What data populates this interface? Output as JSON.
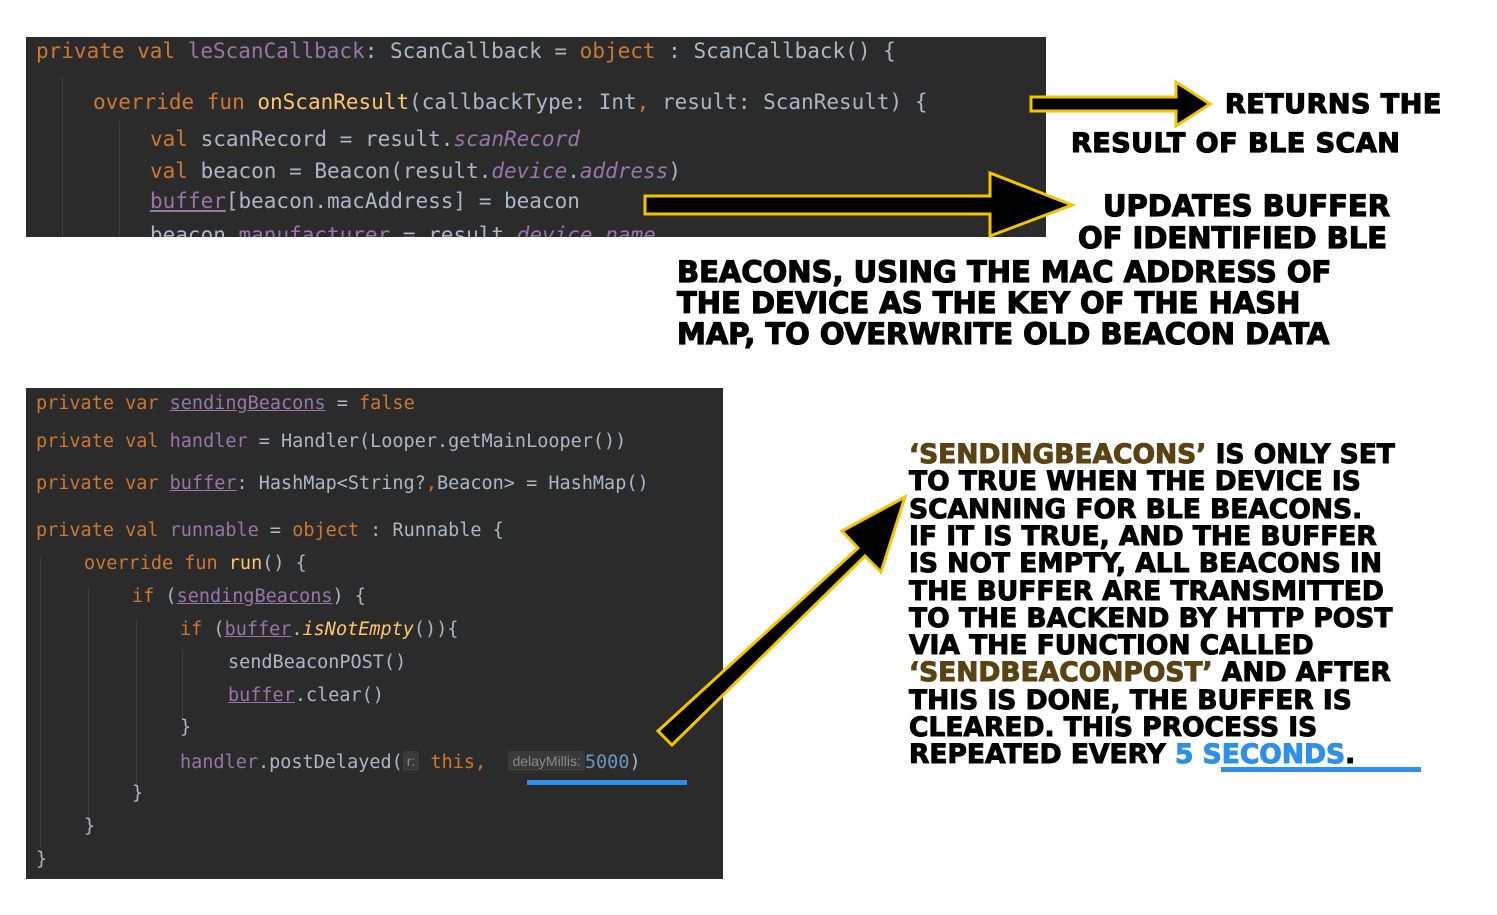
{
  "code_top": {
    "lines": [
      {
        "parts": [
          [
            "kw",
            "private val "
          ],
          [
            "pp",
            "leScanCallback"
          ],
          [
            "plain",
            ": ScanCallback = "
          ],
          [
            "kw",
            "object"
          ],
          [
            "plain",
            " : ScanCallback() {"
          ]
        ]
      },
      {
        "parts": [
          [
            "kw",
            "override fun "
          ],
          [
            "fn",
            "onScanResult"
          ],
          [
            "plain",
            "(callbackType: Int"
          ],
          [
            "kw",
            ","
          ],
          [
            "plain",
            " result: ScanResult) {"
          ]
        ]
      },
      {
        "parts": [
          [
            "kw",
            "val "
          ],
          [
            "plain",
            "scanRecord = result."
          ],
          [
            "ppit",
            "scanRecord"
          ]
        ]
      },
      {
        "parts": [
          [
            "kw",
            "val "
          ],
          [
            "plain",
            "beacon = Beacon(result."
          ],
          [
            "ppit",
            "device"
          ],
          [
            "plain",
            "."
          ],
          [
            "ppit",
            "address"
          ],
          [
            "plain",
            ")"
          ]
        ]
      },
      {
        "parts": [
          [
            "ppul",
            "buffer"
          ],
          [
            "plain",
            "[beacon.macAddress] = beacon"
          ]
        ]
      },
      {
        "parts": [
          [
            "plain",
            "beacon."
          ],
          [
            "pp",
            "manufacturer"
          ],
          [
            "plain",
            " = result."
          ],
          [
            "ppit",
            "device"
          ],
          [
            "plain",
            "."
          ],
          [
            "ppit",
            "name"
          ]
        ]
      }
    ]
  },
  "code_bottom": {
    "lines": [
      {
        "parts": [
          [
            "kw",
            "private var "
          ],
          [
            "ppul",
            "sendingBeacons"
          ],
          [
            "plain",
            " = "
          ],
          [
            "kw",
            "false"
          ]
        ]
      },
      {
        "parts": [
          [
            "kw",
            "private val "
          ],
          [
            "pp",
            "handler"
          ],
          [
            "plain",
            " = Handler(Looper.getMainLooper())"
          ]
        ]
      },
      {
        "parts": [
          [
            "kw",
            "private var "
          ],
          [
            "ppul",
            "buffer"
          ],
          [
            "plain",
            ": HashMap<String?"
          ],
          [
            "kw",
            ","
          ],
          [
            "plain",
            "Beacon> = HashMap()"
          ]
        ]
      },
      {
        "parts": [
          [
            "kw",
            "private val "
          ],
          [
            "pp",
            "runnable"
          ],
          [
            "plain",
            " = "
          ],
          [
            "kw",
            "object"
          ],
          [
            "plain",
            " : Runnable {"
          ]
        ]
      },
      {
        "parts": [
          [
            "kw",
            "override fun "
          ],
          [
            "fn",
            "run"
          ],
          [
            "plain",
            "() {"
          ]
        ]
      },
      {
        "parts": [
          [
            "kw",
            "if "
          ],
          [
            "plain",
            "("
          ],
          [
            "ppul",
            "sendingBeacons"
          ],
          [
            "plain",
            ") {"
          ]
        ]
      },
      {
        "parts": [
          [
            "kw",
            "if "
          ],
          [
            "plain",
            "("
          ],
          [
            "ppul",
            "buffer"
          ],
          [
            "plain",
            "."
          ],
          [
            "fnit",
            "isNotEmpty"
          ],
          [
            "plain",
            "()){"
          ]
        ]
      },
      {
        "parts": [
          [
            "plain",
            "sendBeaconPOST()"
          ]
        ]
      },
      {
        "parts": [
          [
            "ppul",
            "buffer"
          ],
          [
            "plain",
            ".clear()"
          ]
        ]
      },
      {
        "parts": [
          [
            "plain",
            "}"
          ]
        ]
      },
      {
        "parts": [
          [
            "pp",
            "handler"
          ],
          [
            "plain",
            ".postDelayed("
          ],
          [
            "hint",
            "r:"
          ],
          [
            "kw",
            " this, "
          ],
          [
            "plain",
            " "
          ],
          [
            "hint",
            "delayMillis:"
          ],
          [
            "num",
            "5000"
          ],
          [
            "plain",
            ")"
          ]
        ]
      },
      {
        "parts": [
          [
            "plain",
            "}"
          ]
        ]
      },
      {
        "parts": [
          [
            "plain",
            "}"
          ]
        ]
      },
      {
        "parts": [
          [
            "plain",
            "}"
          ]
        ]
      }
    ]
  },
  "notes": {
    "scan_result_line1": "RETURNS THE",
    "scan_result_line2": "RESULT OF BLE SCAN",
    "buffer_lines": [
      "UPDATES BUFFER",
      "OF IDENTIFIED BLE",
      "BEACONS, USING THE MAC ADDRESS OF",
      "THE DEVICE AS THE KEY OF THE HASH",
      "MAP, TO OVERWRITE OLD BEACON DATA"
    ],
    "process_lines": [
      [
        [
          "brown",
          "‘SENDINGBEACONS’"
        ],
        [
          "plain",
          " IS ONLY SET"
        ]
      ],
      [
        [
          "plain",
          "TO TRUE WHEN THE DEVICE IS"
        ]
      ],
      [
        [
          "plain",
          "SCANNING FOR BLE BEACONS."
        ]
      ],
      [
        [
          "plain",
          "IF IT IS TRUE, AND THE BUFFER"
        ]
      ],
      [
        [
          "plain",
          "IS NOT EMPTY, ALL BEACONS IN"
        ]
      ],
      [
        [
          "plain",
          "THE BUFFER ARE TRANSMITTED"
        ]
      ],
      [
        [
          "plain",
          "TO THE BACKEND BY HTTP POST"
        ]
      ],
      [
        [
          "plain",
          "VIA THE FUNCTION CALLED"
        ]
      ],
      [
        [
          "brown",
          "‘SENDBEACONPOST’"
        ],
        [
          "plain",
          " AND AFTER"
        ]
      ],
      [
        [
          "plain",
          "THIS IS DONE, THE BUFFER IS"
        ]
      ],
      [
        [
          "plain",
          "CLEARED. THIS PROCESS IS"
        ]
      ],
      [
        [
          "plain",
          "REPEATED EVERY "
        ],
        [
          "blue",
          "5 SECONDS"
        ],
        [
          "plain",
          "."
        ]
      ]
    ]
  },
  "colors": {
    "code_bg": "#2b2b2b",
    "keyword": "#cc7832",
    "function": "#ffc66d",
    "property": "#9876aa",
    "text": "#a9b7c6",
    "highlight_blue": "#2f8fe8",
    "brown_text": "#5a4312",
    "arrow_outline": "#f2c500"
  }
}
